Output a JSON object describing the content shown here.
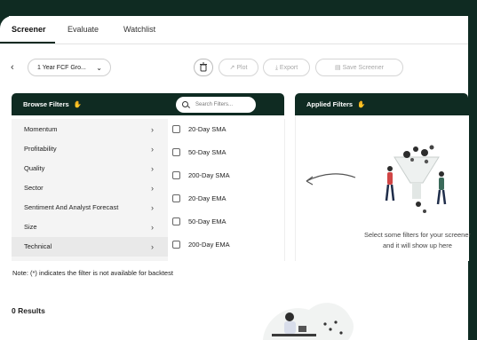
{
  "tabs": [
    {
      "label": "Screener",
      "active": true
    },
    {
      "label": "Evaluate",
      "active": false
    },
    {
      "label": "Watchlist",
      "active": false
    }
  ],
  "toolbar": {
    "back_icon": "chevron-left-icon",
    "preset_value": "1 Year FCF Gro...",
    "delete_icon": "trash-icon",
    "plot_label": "Plot",
    "export_label": "Export",
    "save_label": "Save Screener"
  },
  "browse": {
    "title": "Browse Filters",
    "emoji": "✋",
    "search_placeholder": "Search Filters...",
    "categories": [
      {
        "label": "Momentum"
      },
      {
        "label": "Profitability"
      },
      {
        "label": "Quality"
      },
      {
        "label": "Sector"
      },
      {
        "label": "Sentiment And Analyst Forecast"
      },
      {
        "label": "Size"
      },
      {
        "label": "Technical",
        "selected": true
      }
    ],
    "options": [
      {
        "label": "20-Day SMA",
        "checked": false
      },
      {
        "label": "50-Day SMA",
        "checked": false
      },
      {
        "label": "200-Day SMA",
        "checked": false
      },
      {
        "label": "20-Day EMA",
        "checked": false
      },
      {
        "label": "50-Day EMA",
        "checked": false
      },
      {
        "label": "200-Day EMA",
        "checked": false
      }
    ]
  },
  "applied": {
    "title": "Applied Filters",
    "emoji": "✋",
    "empty_line1": "Select some filters for your screener",
    "empty_line2": "and it will show up here"
  },
  "note": "Note: (*) indicates the filter is not available for backtest",
  "results_label": "0 Results",
  "colors": {
    "primary": "#0f2b22",
    "accent": "#f2a33a"
  }
}
